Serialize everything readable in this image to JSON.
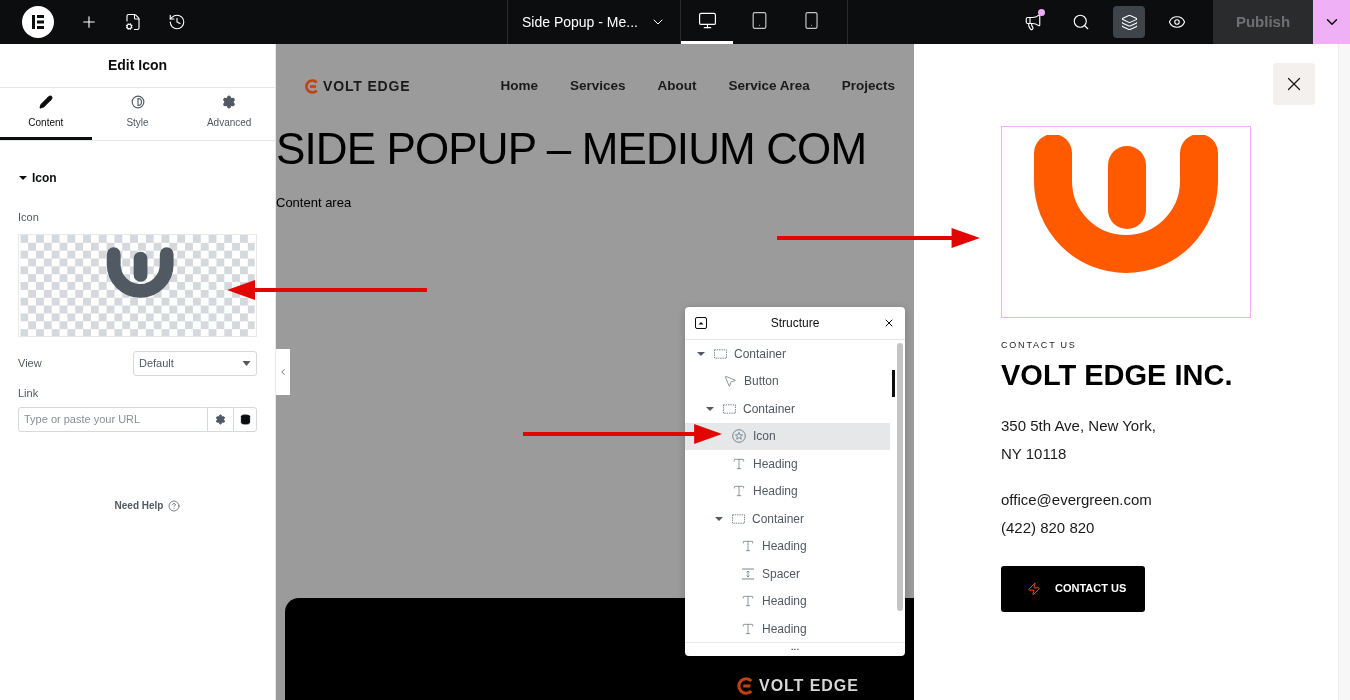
{
  "topbar": {
    "document_title": "Side Popup - Me...",
    "devices": [
      {
        "kind": "desktop",
        "selected": true
      },
      {
        "kind": "tablet",
        "selected": false
      },
      {
        "kind": "mobile",
        "selected": false
      }
    ],
    "notification": {
      "unread": true
    },
    "structure_toggle": {
      "selected": true
    },
    "publish": {
      "label": "Publish",
      "disabled": true
    }
  },
  "panel": {
    "title": "Edit Icon",
    "tabs": [
      {
        "kind": "content",
        "label": "Content",
        "selected": true
      },
      {
        "kind": "style",
        "label": "Style",
        "selected": false
      },
      {
        "kind": "advanced",
        "label": "Advanced",
        "selected": false
      }
    ],
    "section": {
      "title": "Icon",
      "expanded": true
    },
    "icon_label": "Icon",
    "view": {
      "label": "View",
      "value": "Default"
    },
    "link": {
      "label": "Link",
      "placeholder": "Type or paste your URL"
    },
    "help": "Need Help"
  },
  "canvas": {
    "logo": "VOLT EDGE",
    "nav": [
      "Home",
      "Services",
      "About",
      "Service Area",
      "Projects"
    ],
    "heading": "SIDE POPUP – MEDIUM COM",
    "text": "Content area",
    "footer_logo": "VOLT EDGE"
  },
  "structure": {
    "title": "Structure",
    "tree": [
      {
        "kind": "container",
        "label": "Container",
        "expanded": true,
        "selected": false,
        "children": [
          {
            "kind": "button",
            "label": "Button",
            "selected": false
          },
          {
            "kind": "container",
            "label": "Container",
            "expanded": true,
            "selected": false,
            "children": [
              {
                "kind": "icon",
                "label": "Icon",
                "selected": true
              },
              {
                "kind": "heading",
                "label": "Heading",
                "selected": false
              },
              {
                "kind": "heading",
                "label": "Heading",
                "selected": false
              },
              {
                "kind": "container",
                "label": "Container",
                "expanded": true,
                "selected": false,
                "children": [
                  {
                    "kind": "heading",
                    "label": "Heading",
                    "selected": false
                  },
                  {
                    "kind": "spacer",
                    "label": "Spacer",
                    "selected": false
                  },
                  {
                    "kind": "heading",
                    "label": "Heading",
                    "selected": false
                  },
                  {
                    "kind": "heading",
                    "label": "Heading",
                    "selected": false
                  }
                ]
              }
            ]
          }
        ]
      }
    ],
    "more": "..."
  },
  "popup": {
    "eyebrow": "CONTACT US",
    "title": "VOLT EDGE INC.",
    "address": [
      "350 5th Ave, New York,",
      "NY 10118"
    ],
    "contacts": [
      "office@evergreen.com",
      "(422) 820 820"
    ],
    "button": "CONTACT US"
  }
}
